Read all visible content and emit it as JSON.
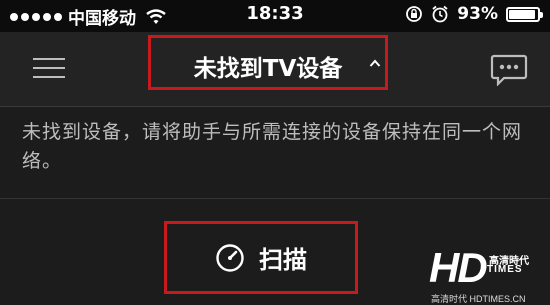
{
  "status_bar": {
    "carrier": "中国移动",
    "time": "18:33",
    "battery_percent": "93%",
    "battery_level": 0.93,
    "signal_dots": 5,
    "icons": [
      "signal-dots-icon",
      "wifi-icon",
      "rotation-lock-icon",
      "alarm-icon",
      "battery-icon"
    ]
  },
  "navbar": {
    "title": "未找到TV设备",
    "caret": "^",
    "icons": [
      "menu-icon",
      "chevron-up-icon",
      "chat-icon"
    ]
  },
  "message": "未找到设备，请将助手与所需连接的设备保持在同一个网络。",
  "scan_button": {
    "label": "扫描",
    "icon": "gauge-icon"
  },
  "watermark": {
    "logo_text": "HD",
    "brand_cn": "高清時代",
    "brand_en": "TIMES",
    "url": "高清时代 HDTIMES.CN"
  },
  "colors": {
    "highlight": "#c8191c",
    "background": "#1c1c1c",
    "navbar": "#232323",
    "message_text": "#bdbdbd"
  }
}
